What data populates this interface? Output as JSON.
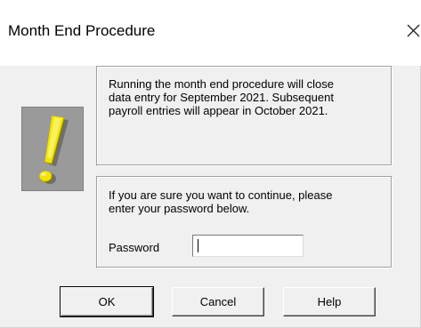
{
  "window": {
    "title": "Month End Procedure",
    "close_glyph": "close-icon"
  },
  "warning_icon": {
    "icon": "exclamation-icon",
    "color": "#f2e600"
  },
  "info_group": {
    "lines": [
      "Running the month end procedure will close",
      "data entry for September 2021.  Subsequent",
      "payroll entries will appear in October 2021."
    ]
  },
  "confirm_group": {
    "lines": [
      "If you are sure you want to continue, please",
      "enter your password below."
    ],
    "password_label": "Password",
    "password_value": ""
  },
  "buttons": {
    "ok": "OK",
    "cancel": "Cancel",
    "help": "Help"
  }
}
